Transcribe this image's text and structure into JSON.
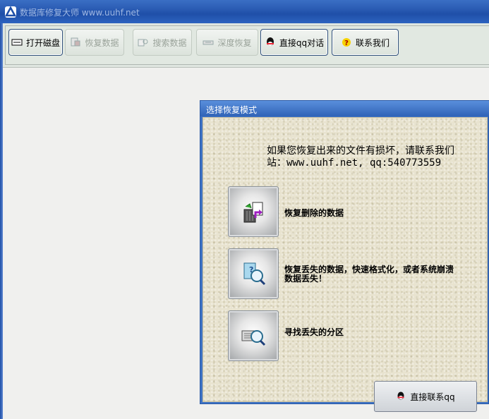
{
  "window": {
    "title": "数据库修复大师 www.uuhf.net"
  },
  "toolbar": {
    "buttons": [
      {
        "label": "打开磁盘",
        "icon": "disk-icon",
        "enabled": true
      },
      {
        "label": "恢复数据",
        "icon": "recover-icon",
        "enabled": false
      },
      {
        "label": "搜索数据",
        "icon": "search-data-icon",
        "enabled": false
      },
      {
        "label": "深度恢复",
        "icon": "deep-recover-icon",
        "enabled": false
      },
      {
        "label": "直接qq对话",
        "icon": "qq-icon",
        "enabled": true
      },
      {
        "label": "联系我们",
        "icon": "help-icon",
        "enabled": true
      }
    ]
  },
  "dialog": {
    "title": "选择恢复模式",
    "message_line1": "如果您恢复出来的文件有损坏，请联系我们",
    "message_line2": "站：www.uuhf.net, qq:540773559",
    "options": [
      {
        "label": "恢复删除的数据",
        "icon": "recycle-bin-icon"
      },
      {
        "label_line1": "恢复丢失的数据，快速格式化，或者系统崩溃",
        "label_line2": "数据丢失！",
        "icon": "magnifier-document-icon"
      },
      {
        "label": "寻找丢失的分区",
        "icon": "partition-search-icon"
      }
    ],
    "qq_button_label": "直接联系qq"
  },
  "colors": {
    "titlebar": "#2a5bb3",
    "dialog_body": "#e8e3cf",
    "toolbar": "#dfe6e0"
  }
}
